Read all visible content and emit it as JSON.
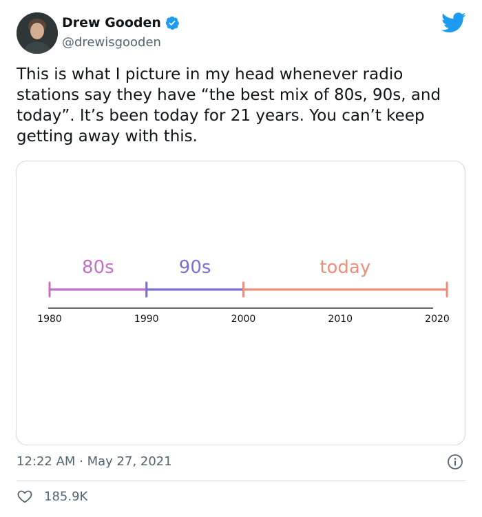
{
  "tweet": {
    "display_name": "Drew Gooden",
    "handle": "@drewisgooden",
    "text": "This is what I picture in my head whenever radio stations say they have “the best mix of 80s, 90s, and today”. It’s been today for 21 years. You can’t keep getting away with this.",
    "timestamp": "12:22 AM · May 27, 2021",
    "like_count": "185.9K"
  },
  "icons": {
    "verified": "verified-badge-icon",
    "brand": "twitter-bird-icon",
    "info": "info-icon",
    "like": "heart-icon"
  },
  "colors": {
    "verified": "#1d9bf0",
    "twitter_blue": "#1d9bf0",
    "text_primary": "#0f1419",
    "text_secondary": "#536471",
    "border": "#cfd9de"
  },
  "chart_data": {
    "type": "timeline",
    "x_ticks": [
      "1980",
      "1990",
      "2000",
      "2010",
      "2020"
    ],
    "xlim": [
      1980,
      2021
    ],
    "segments": [
      {
        "label": "80s",
        "start": 1980,
        "end": 1990,
        "color": "#c26fc7"
      },
      {
        "label": "90s",
        "start": 1990,
        "end": 2000,
        "color": "#7b70cf"
      },
      {
        "label": "today",
        "start": 2000,
        "end": 2021,
        "color": "#ec8f7a"
      }
    ]
  }
}
